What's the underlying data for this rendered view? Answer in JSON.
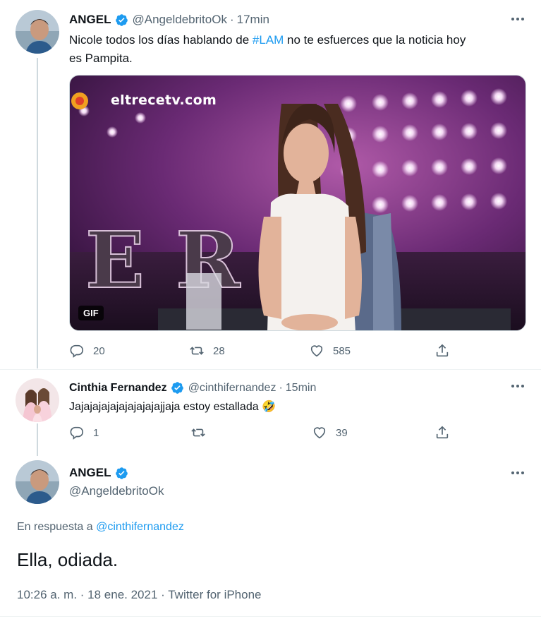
{
  "tweet1": {
    "name": "ANGEL",
    "handle": "@AngeldebritoOk",
    "dot": "·",
    "time": "17min",
    "text_before": "Nicole todos los días hablando de ",
    "hashtag": "#LAM",
    "text_after": " no te esfuerces que la noticia hoy",
    "text_line2": "es Pampita.",
    "media_watermark": "eltrecetv.com",
    "media_badge": "GIF",
    "replies": "20",
    "retweets": "28",
    "likes": "585"
  },
  "tweet2": {
    "name": "Cinthia Fernandez",
    "handle": "@cinthifernandez",
    "dot": "·",
    "time": "15min",
    "text": "Jajajajajajajajajajajjaja estoy estallada",
    "emoji": "🤣",
    "replies": "1",
    "retweets": "",
    "likes": "39"
  },
  "tweet3": {
    "name": "ANGEL",
    "handle": "@AngeldebritoOk",
    "reply_prefix": "En respuesta a ",
    "reply_mention": "@cinthifernandez",
    "text": "Ella, odiada.",
    "meta": "10:26 a. m. · 18 ene. 2021 · Twitter for iPhone"
  },
  "colors": {
    "link": "#1d9bf0",
    "secondary": "#536471",
    "verified": "#1d9bf0"
  },
  "icons": [
    "reply-icon",
    "retweet-icon",
    "like-icon",
    "share-icon",
    "verified-icon",
    "more-icon"
  ]
}
